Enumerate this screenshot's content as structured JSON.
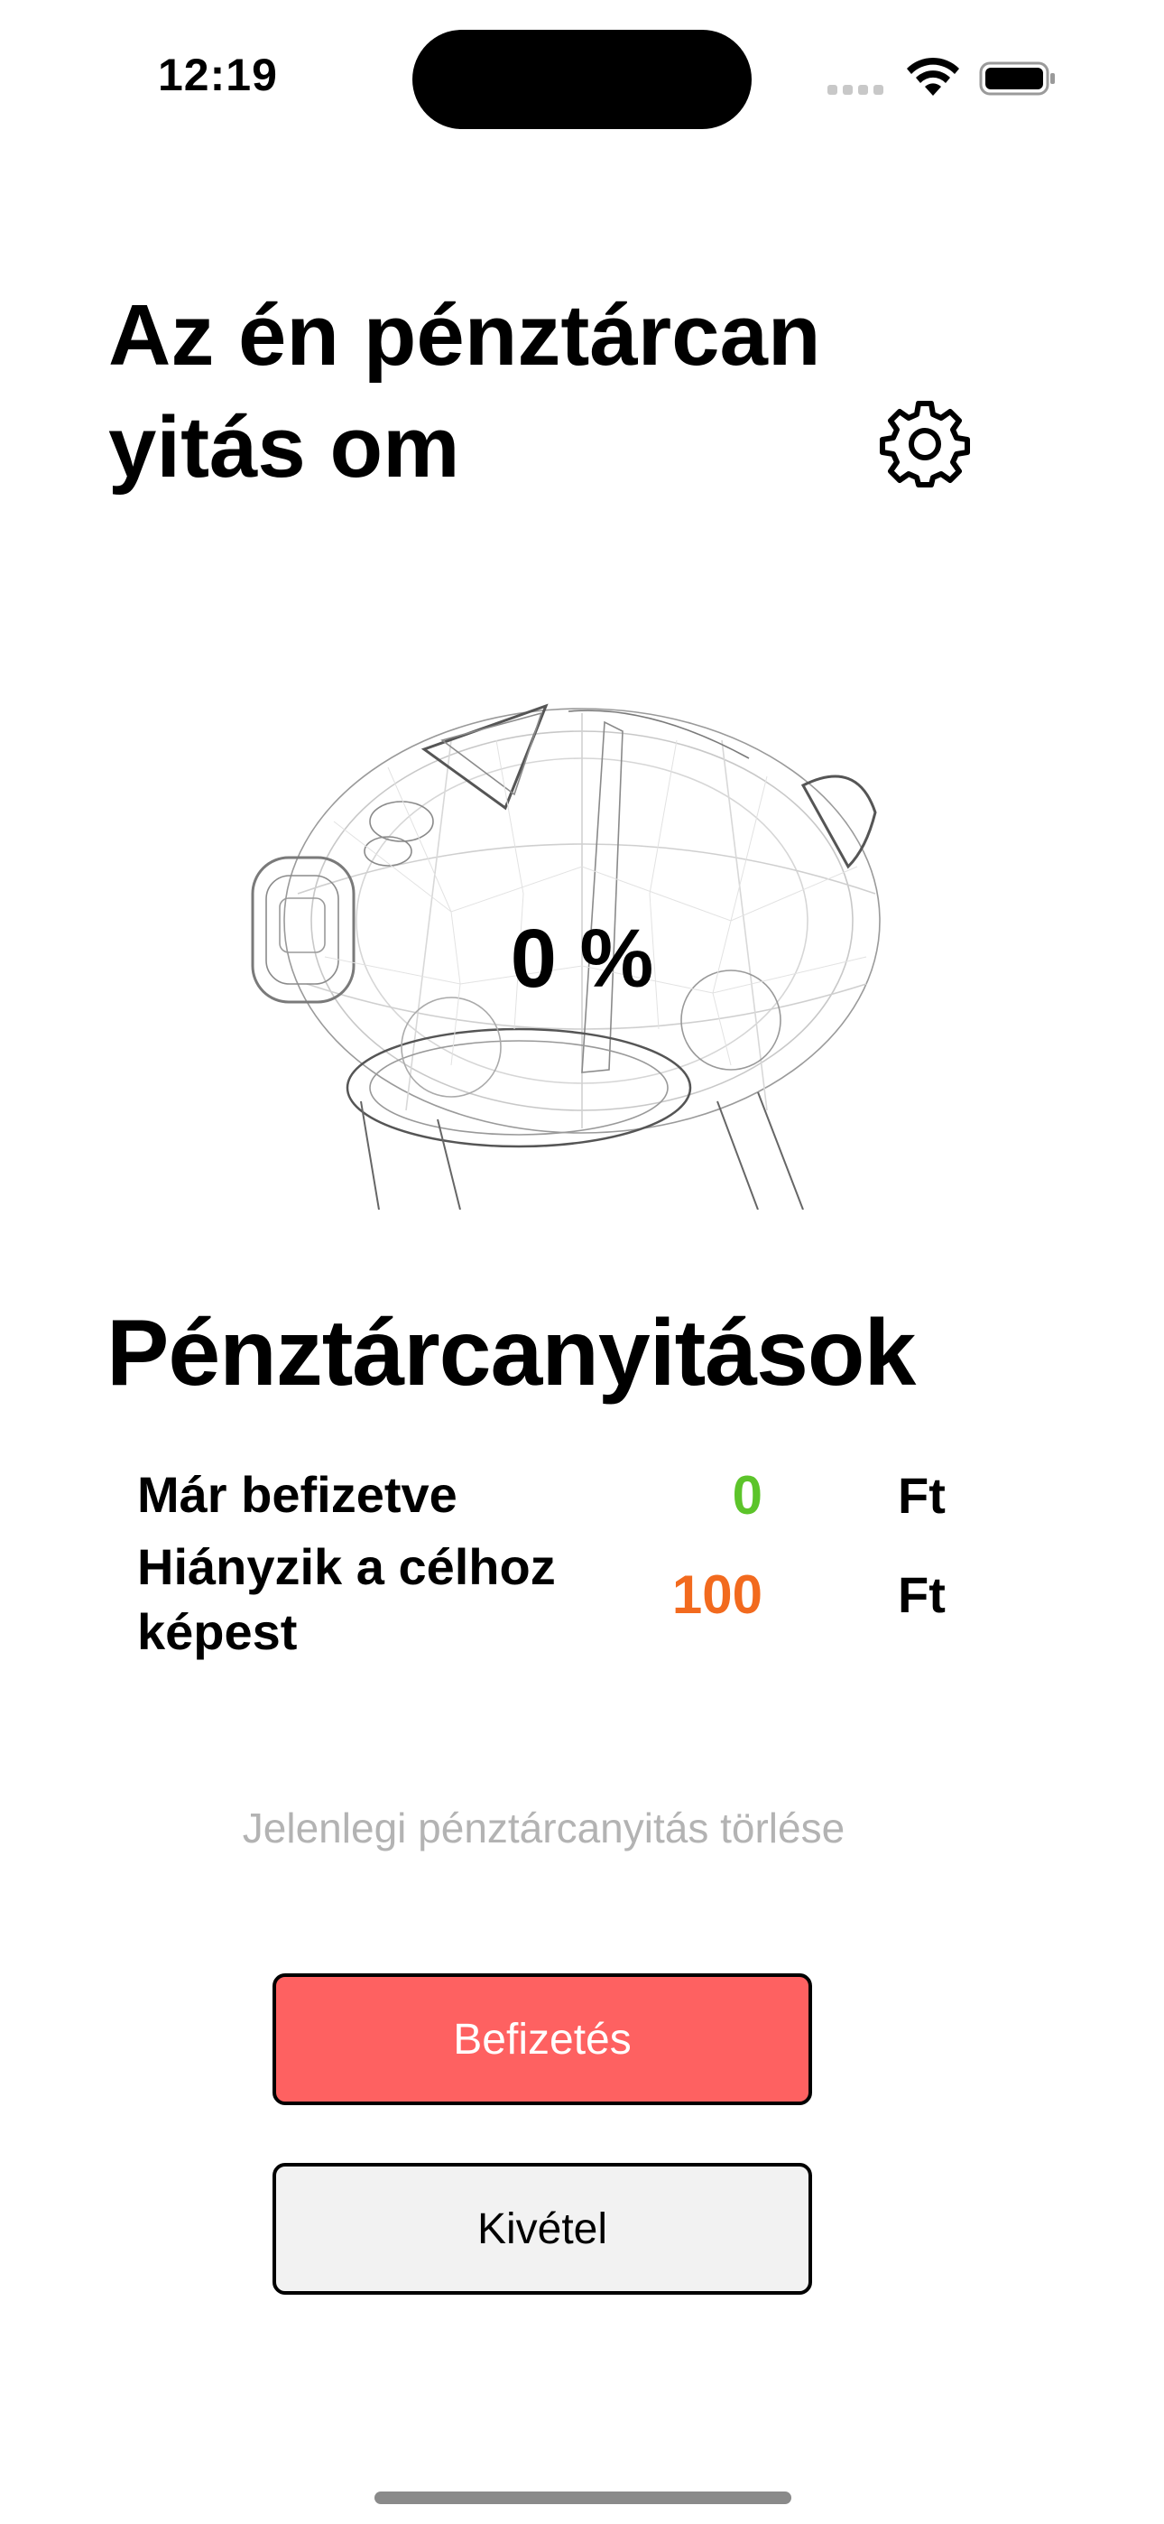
{
  "status_bar": {
    "time": "12:19"
  },
  "header": {
    "title": "Az én pénztárcanyitás om",
    "settings_icon": "gear-icon"
  },
  "piggy": {
    "icon": "piggy-bank-wireframe",
    "percent": "0 %"
  },
  "summary": {
    "title": "Pénztárcanyitások",
    "rows": [
      {
        "label": "Már befizetve",
        "value": "0",
        "unit": "Ft",
        "color": "#5cc42a"
      },
      {
        "label": "Hiányzik a célhoz képest",
        "value": "100",
        "unit": "Ft",
        "color": "#f26a1e"
      }
    ]
  },
  "actions": {
    "delete_label": "Jelenlegi pénztárcanyitás törlése",
    "deposit_label": "Befizetés",
    "deposit_color": "#fe6161",
    "withdraw_label": "Kivétel"
  }
}
